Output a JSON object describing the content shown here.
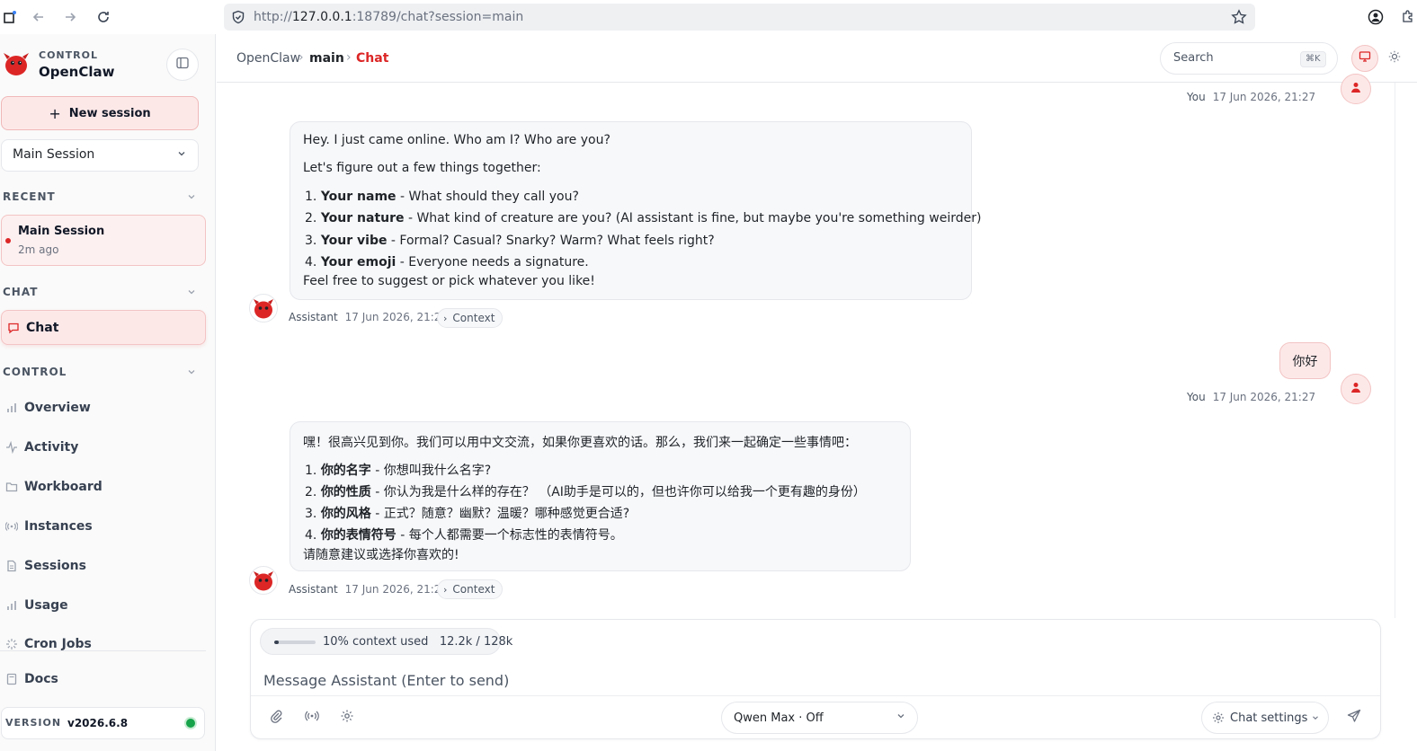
{
  "browser": {
    "url_scheme": "http://",
    "url_host": "127.0.0.1",
    "url_rest": ":18789/chat?session=main"
  },
  "sidebar": {
    "brand_sub": "CONTROL",
    "brand_title": "OpenClaw",
    "new_session_label": "New session",
    "session_select_value": "Main Session",
    "recent_label": "RECENT",
    "recent_item": {
      "name": "Main Session",
      "time": "2m ago"
    },
    "chat_section_label": "CHAT",
    "chat_item_label": "Chat",
    "control_section_label": "CONTROL",
    "nav": [
      {
        "label": "Overview",
        "icon": "bar-chart-icon"
      },
      {
        "label": "Activity",
        "icon": "activity-icon"
      },
      {
        "label": "Workboard",
        "icon": "folder-icon"
      },
      {
        "label": "Instances",
        "icon": "broadcast-icon"
      },
      {
        "label": "Sessions",
        "icon": "document-icon"
      },
      {
        "label": "Usage",
        "icon": "bar-chart-icon"
      },
      {
        "label": "Cron Jobs",
        "icon": "spinner-icon"
      }
    ],
    "docs_label": "Docs",
    "version_label": "VERSION",
    "version_value": "v2026.6.8",
    "status_color": "#16a34a"
  },
  "header": {
    "breadcrumb": [
      "OpenClaw",
      "main",
      "Chat"
    ],
    "separator": "›",
    "search_placeholder": "Search",
    "search_shortcut": "⌘K",
    "accent_color": "#dc2626"
  },
  "messages": {
    "top_user_meta": {
      "name": "You",
      "time": "17 Jun 2026, 21:27"
    },
    "assistant_1": {
      "intro": "Hey. I just came online. Who am I? Who are you?",
      "lead": "Let's figure out a few things together:",
      "items": [
        {
          "num": "1.",
          "bold": "Your name",
          "rest": " - What should they call you?"
        },
        {
          "num": "2.",
          "bold": "Your nature",
          "rest": " - What kind of creature are you? (AI assistant is fine, but maybe you're something weirder)"
        },
        {
          "num": "3.",
          "bold": "Your vibe",
          "rest": " - Formal? Casual? Snarky? Warm? What feels right?"
        },
        {
          "num": "4.",
          "bold": "Your emoji",
          "rest": " - Everyone needs a signature."
        }
      ],
      "closing": "Feel free to suggest or pick whatever you like!",
      "meta_name": "Assistant",
      "meta_time": "17 Jun 2026, 21:27",
      "context_label": "Context"
    },
    "user_1": {
      "text": "你好",
      "meta_name": "You",
      "meta_time": "17 Jun 2026, 21:27"
    },
    "assistant_2": {
      "intro": "嘿！很高兴见到你。我们可以用中文交流，如果你更喜欢的话。那么，我们来一起确定一些事情吧：",
      "items": [
        {
          "num": "1.",
          "bold": "你的名字",
          "rest": " - 你想叫我什么名字?"
        },
        {
          "num": "2.",
          "bold": "你的性质",
          "rest": " - 你认为我是什么样的存在？ （AI助手是可以的，但也许你可以给我一个更有趣的身份）"
        },
        {
          "num": "3.",
          "bold": "你的风格",
          "rest": " - 正式？随意？幽默？温暖？哪种感觉更合适?"
        },
        {
          "num": "4.",
          "bold": "你的表情符号",
          "rest": " - 每个人都需要一个标志性的表情符号。"
        }
      ],
      "closing": "请随意建议或选择你喜欢的!",
      "meta_name": "Assistant",
      "meta_time": "17 Jun 2026, 21:27",
      "context_label": "Context"
    }
  },
  "composer": {
    "context_used_label": "10% context used",
    "context_used_fraction": 0.1,
    "context_tokens": "12.2k / 128k",
    "placeholder": "Message Assistant (Enter to send)",
    "model_select_value": "Qwen Max · Off",
    "chat_settings_label": "Chat settings"
  }
}
